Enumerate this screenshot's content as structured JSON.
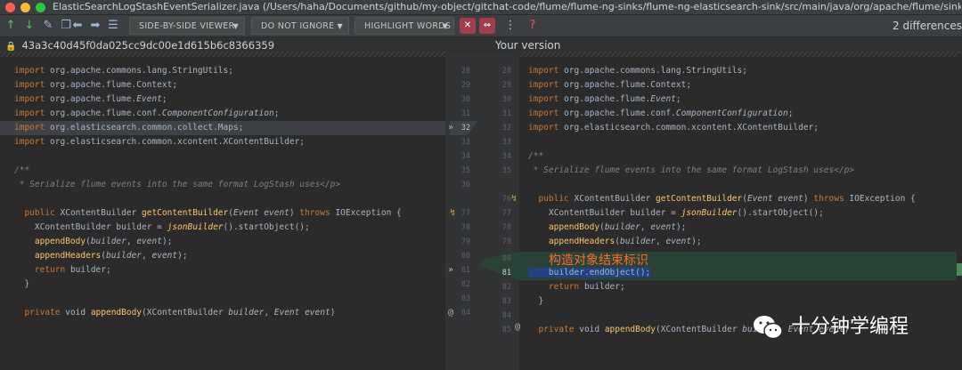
{
  "window": {
    "title": "ElasticSearchLogStashEventSerializer.java (/Users/haha/Documents/github/my-object/gitchat-code/flume/flume-ng-sinks/flume-ng-elasticsearch-sink/src/main/java/org/apache/flume/sink/elastics..."
  },
  "toolbar": {
    "viewer_label": "SIDE-BY-SIDE VIEWER",
    "ignore_label": "DO NOT IGNORE",
    "highlight_label": "HIGHLIGHT WORDS",
    "diff_count": "2 differences"
  },
  "header": {
    "left_revision": "43a3c40d45f0da025cc9dc00e1d615b6c8366359",
    "right_label": "Your version"
  },
  "left_lines": [
    {
      "text": "import org.apache.commons.lang.StringUtils;",
      "ln": "28"
    },
    {
      "text": "import org.apache.flume.Context;",
      "ln": "29"
    },
    {
      "text": "import org.apache.flume.Event;",
      "ln": "30"
    },
    {
      "text": "import org.apache.flume.conf.ComponentConfiguration;",
      "ln": "31"
    },
    {
      "text": "import org.elasticsearch.common.collect.Maps;",
      "ln": "32"
    },
    {
      "text": "import org.elasticsearch.common.xcontent.XContentBuilder;",
      "ln": "33"
    },
    {
      "text": "",
      "ln": "34"
    },
    {
      "text": "/**",
      "ln": "35"
    },
    {
      "text": " * Serialize flume events into the same format LogStash uses</p>",
      "ln": "36"
    },
    {
      "text": "",
      "ln": ""
    },
    {
      "text": "  public XContentBuilder getContentBuilder(Event event) throws IOException {",
      "ln": "77"
    },
    {
      "text": "    XContentBuilder builder = jsonBuilder().startObject();",
      "ln": "78"
    },
    {
      "text": "    appendBody(builder, event);",
      "ln": "79"
    },
    {
      "text": "    appendHeaders(builder, event);",
      "ln": "80"
    },
    {
      "text": "    return builder;",
      "ln": "81"
    },
    {
      "text": "  }",
      "ln": "82"
    },
    {
      "text": "",
      "ln": "83"
    },
    {
      "text": "  private void appendBody(XContentBuilder builder, Event event)",
      "ln": "84"
    }
  ],
  "right_lines": [
    {
      "text": "import org.apache.commons.lang.StringUtils;",
      "ln": "28"
    },
    {
      "text": "import org.apache.flume.Context;",
      "ln": "29"
    },
    {
      "text": "import org.apache.flume.Event;",
      "ln": "30"
    },
    {
      "text": "import org.apache.flume.conf.ComponentConfiguration;",
      "ln": "31"
    },
    {
      "text": "import org.elasticsearch.common.xcontent.XContentBuilder;",
      "ln": "32"
    },
    {
      "text": "",
      "ln": "33"
    },
    {
      "text": "/**",
      "ln": "34"
    },
    {
      "text": " * Serialize flume events into the same format LogStash uses</p>",
      "ln": "35"
    },
    {
      "text": "",
      "ln": ""
    },
    {
      "text": "  public XContentBuilder getContentBuilder(Event event) throws IOException {",
      "ln": "76"
    },
    {
      "text": "    XContentBuilder builder = jsonBuilder().startObject();",
      "ln": "77"
    },
    {
      "text": "    appendBody(builder, event);",
      "ln": "78"
    },
    {
      "text": "    appendHeaders(builder, event);",
      "ln": "79"
    },
    {
      "text": "",
      "ln": "80"
    },
    {
      "text": "    builder.endObject();",
      "ln": "81"
    },
    {
      "text": "    return builder;",
      "ln": "82"
    },
    {
      "text": "  }",
      "ln": "83"
    },
    {
      "text": "",
      "ln": "84"
    },
    {
      "text": "  private void appendBody(XContentBuilder builder, Event event)",
      "ln": "85"
    }
  ],
  "annotation": "构造对象结束标识",
  "watermark": "十分钟学编程",
  "icons": {
    "up": "arrow-up-icon",
    "down": "arrow-down-icon",
    "edit": "edit-icon",
    "copy": "copy-icon",
    "left": "arrow-left-icon",
    "right": "arrow-right-icon",
    "list": "list-icon",
    "help": "help-icon"
  },
  "colors": {
    "added_bg": "#294436",
    "changed_bg": "#3e4146",
    "accent_red": "#a03d4f",
    "annotation": "#ff6a2a"
  }
}
